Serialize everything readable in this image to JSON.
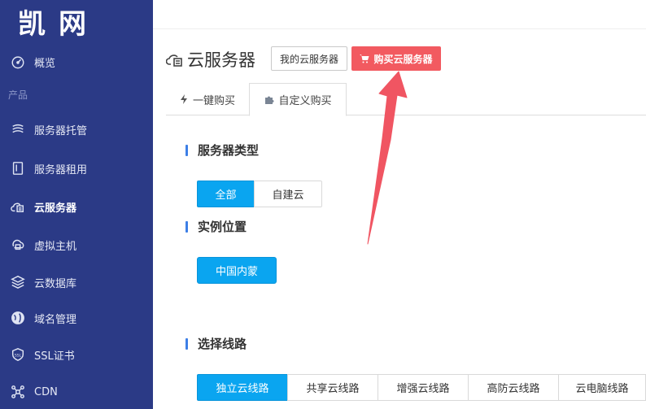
{
  "sidebar": {
    "logo": "凯网",
    "items": [
      {
        "label": "概览",
        "icon": "dashboard-icon"
      },
      {
        "label": "服务器托管",
        "icon": "server-hosting-icon"
      },
      {
        "label": "服务器租用",
        "icon": "server-rent-icon"
      },
      {
        "label": "云服务器",
        "icon": "cloud-server-icon",
        "active": true
      },
      {
        "label": "虚拟主机",
        "icon": "virtual-host-icon"
      },
      {
        "label": "云数据库",
        "icon": "database-icon"
      },
      {
        "label": "域名管理",
        "icon": "globe-icon"
      },
      {
        "label": "SSL证书",
        "icon": "shield-icon"
      },
      {
        "label": "CDN",
        "icon": "cdn-icon"
      }
    ],
    "section_label": "产品"
  },
  "header": {
    "title": "云服务器",
    "my_servers_label": "我的云服务器",
    "buy_label": "购买云服务器"
  },
  "tabs": [
    {
      "label": "一键购买",
      "icon": "lightning-icon"
    },
    {
      "label": "自定义购买",
      "icon": "puzzle-icon",
      "active": true
    }
  ],
  "sections": {
    "type": {
      "title": "服务器类型",
      "options": [
        "全部",
        "自建云"
      ],
      "selected": "全部"
    },
    "location": {
      "title": "实例位置",
      "options": [
        "中国内蒙"
      ],
      "selected": "中国内蒙"
    },
    "line": {
      "title": "选择线路",
      "options": [
        "独立云线路",
        "共享云线路",
        "增强云线路",
        "高防云线路",
        "云电脑线路"
      ],
      "selected": "独立云线路"
    }
  },
  "colors": {
    "sidebar_bg": "#2b3a86",
    "accent": "#0aa5f0",
    "buy_button": "#f25a60",
    "annotation_arrow": "#f05562"
  }
}
